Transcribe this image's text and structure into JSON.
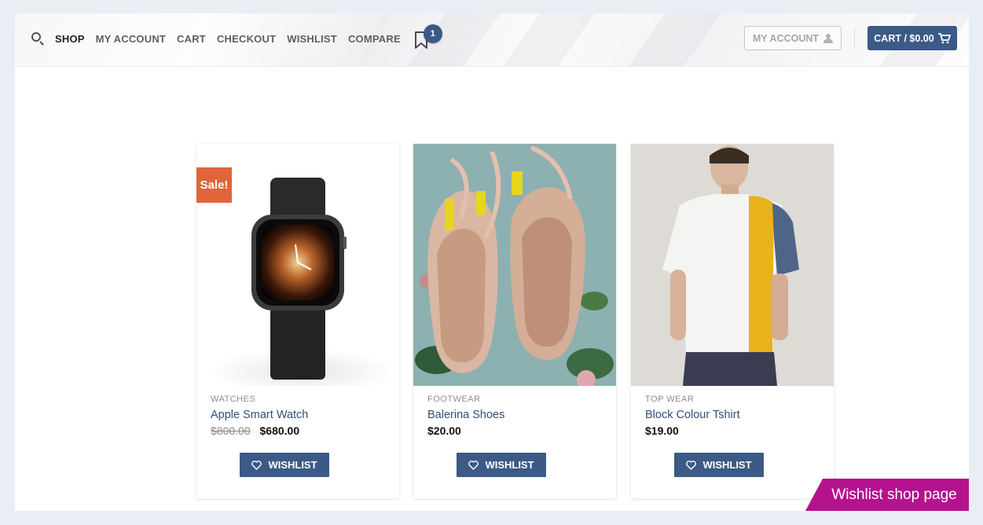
{
  "nav": {
    "items": [
      {
        "label": "SHOP"
      },
      {
        "label": "MY ACCOUNT"
      },
      {
        "label": "CART"
      },
      {
        "label": "CHECKOUT"
      },
      {
        "label": "WISHLIST"
      },
      {
        "label": "COMPARE"
      }
    ],
    "wishlist_count": "1",
    "account_label": "MY ACCOUNT",
    "cart_label": "CART / $0.00"
  },
  "products": [
    {
      "category": "WATCHES",
      "name": "Apple Smart Watch",
      "old_price": "$800.00",
      "price": "$680.00",
      "sale_label": "Sale!",
      "button": "WISHLIST"
    },
    {
      "category": "FOOTWEAR",
      "name": "Balerina Shoes",
      "price": "$20.00",
      "button": "WISHLIST"
    },
    {
      "category": "TOP WEAR",
      "name": "Block Colour Tshirt",
      "price": "$19.00",
      "button": "WISHLIST"
    }
  ],
  "ribbon": {
    "label": "Wishlist shop page"
  },
  "colors": {
    "accent": "#3b5a86",
    "sale": "#e0653a",
    "ribbon": "#b5128f"
  }
}
